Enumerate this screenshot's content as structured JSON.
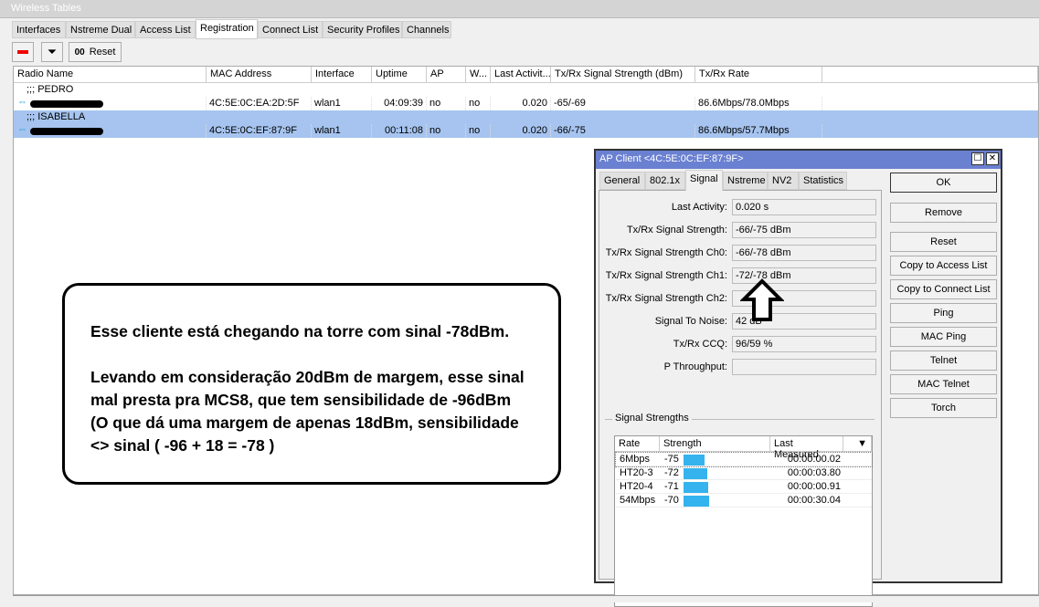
{
  "window": {
    "title": "Wireless Tables"
  },
  "tabs": [
    "Interfaces",
    "Nstreme Dual",
    "Access List",
    "Registration",
    "Connect List",
    "Security Profiles",
    "Channels"
  ],
  "active_tab": "Registration",
  "toolbar": {
    "remove_icon": "minus-icon",
    "filter_icon": "filter-icon",
    "reset_label": "Reset",
    "reset_icon_text": "00"
  },
  "table": {
    "columns": [
      "Radio Name",
      "MAC Address",
      "Interface",
      "Uptime",
      "AP",
      "W...",
      "Last Activit...",
      "Tx/Rx Signal Strength (dBm)",
      "Tx/Rx Rate"
    ],
    "groups": [
      {
        "comment": ";;; PEDRO",
        "mac": "4C:5E:0C:EA:2D:5F",
        "interface": "wlan1",
        "uptime": "04:09:39",
        "ap": "no",
        "w": "no",
        "last_activity": "0.020",
        "signal": "-65/-69",
        "rate": "86.6Mbps/78.0Mbps",
        "selected": false
      },
      {
        "comment": ";;; ISABELLA",
        "mac": "4C:5E:0C:EF:87:9F",
        "interface": "wlan1",
        "uptime": "00:11:08",
        "ap": "no",
        "w": "no",
        "last_activity": "0.020",
        "signal": "-66/-75",
        "rate": "86.6Mbps/57.7Mbps",
        "selected": true
      }
    ]
  },
  "dialog": {
    "title": "AP Client <4C:5E:0C:EF:87:9F>",
    "tabs": [
      "General",
      "802.1x",
      "Signal",
      "Nstreme",
      "NV2",
      "Statistics"
    ],
    "active_tab": "Signal",
    "fields": [
      {
        "label": "Last Activity:",
        "value": "0.020 s"
      },
      {
        "label": "Tx/Rx Signal Strength:",
        "value": "-66/-75 dBm"
      },
      {
        "label": "Tx/Rx Signal Strength Ch0:",
        "value": "-66/-78 dBm"
      },
      {
        "label": "Tx/Rx Signal Strength Ch1:",
        "value": "-72/-78 dBm"
      },
      {
        "label": "Tx/Rx Signal Strength Ch2:",
        "value": ""
      },
      {
        "label": "Signal To Noise:",
        "value": "42 dB"
      },
      {
        "label": "Tx/Rx CCQ:",
        "value": "96/59 %"
      },
      {
        "label": "P Throughput:",
        "value": ""
      }
    ],
    "group_label": "Signal Strengths",
    "ss_columns": [
      "Rate",
      "Strength",
      "Last Measured"
    ],
    "ss_rows": [
      {
        "rate": "6Mbps",
        "strength": "-75",
        "last": "00:00:00.02"
      },
      {
        "rate": "HT20-3",
        "strength": "-72",
        "last": "00:00:03.80"
      },
      {
        "rate": "HT20-4",
        "strength": "-71",
        "last": "00:00:00.91"
      },
      {
        "rate": "54Mbps",
        "strength": "-70",
        "last": "00:00:30.04"
      }
    ],
    "buttons": [
      "OK",
      "Remove",
      "Reset",
      "Copy to Access List",
      "Copy to Connect List",
      "Ping",
      "MAC Ping",
      "Telnet",
      "MAC Telnet",
      "Torch"
    ],
    "bar_color": "#35b3ee",
    "title_color": "#6a80d1"
  },
  "annotation": {
    "line1": "Esse cliente está chegando na torre com sinal -78dBm.",
    "line2": "Levando em consideração 20dBm de margem, esse sinal mal presta pra MCS8, que tem sensibilidade de -96dBm (O que dá uma margem de apenas 18dBm, sensibilidade <> sinal ( -96 + 18 = -78 )"
  }
}
